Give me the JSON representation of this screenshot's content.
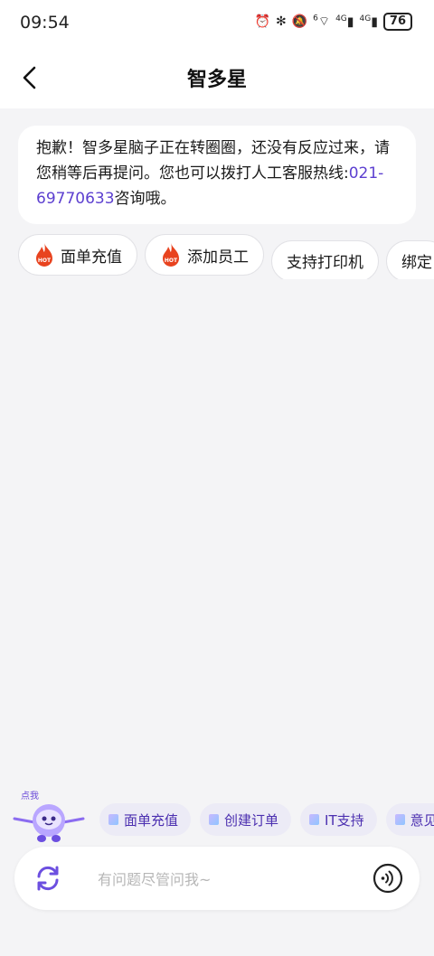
{
  "status_bar": {
    "time": "09:54",
    "icons": [
      "alarm-icon",
      "bluetooth-icon",
      "vibrate-icon",
      "mute-icon",
      "wifi-icon",
      "signal-4g-icon",
      "signal-4g-icon"
    ],
    "wifi_label": "6",
    "sig1_label": "4G",
    "sig2_label": "4G",
    "battery": "76"
  },
  "header": {
    "title": "智多星"
  },
  "message": {
    "text": "抱歉！智多星脑子正在转圈圈，还没有反应过来，请您稍等后再提问。您也可以拨打人工客服热线:",
    "phone": "021-69770633",
    "suffix": "咨询哦。"
  },
  "chips": [
    {
      "label": "面单充值",
      "hot": true
    },
    {
      "label": "添加员工",
      "hot": true
    },
    {
      "label": "支持打印机",
      "hot": false
    },
    {
      "label": "绑定",
      "hot": false
    }
  ],
  "mascot": {
    "label": "点我"
  },
  "quick_actions": [
    "面单充值",
    "创建订单",
    "IT支持",
    "意见反馈"
  ],
  "input": {
    "placeholder": "有问题尽管问我~",
    "value": ""
  },
  "colors": {
    "accent": "#5c3fd0",
    "background": "#f4f4f6",
    "hot": "#e8431f"
  }
}
